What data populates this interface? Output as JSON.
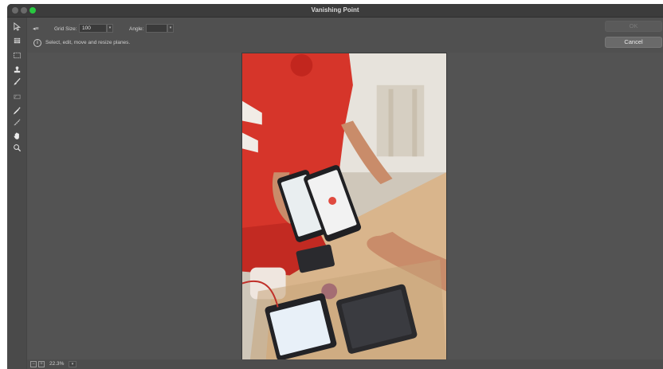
{
  "window": {
    "title": "Vanishing Point"
  },
  "tools": [
    {
      "icon": "edit-plane-icon"
    },
    {
      "icon": "create-plane-icon"
    },
    {
      "icon": "marquee-icon"
    },
    {
      "icon": "stamp-icon"
    },
    {
      "icon": "brush-icon"
    },
    {
      "icon": "transform-icon"
    },
    {
      "icon": "eyedropper-icon"
    },
    {
      "icon": "measure-icon"
    },
    {
      "icon": "hand-icon"
    },
    {
      "icon": "zoom-icon"
    }
  ],
  "options": {
    "back_glyph": "◂≡",
    "grid_size_label": "Grid Size:",
    "grid_size_value": "100",
    "angle_label": "Angle:",
    "angle_value": "",
    "info_text": "Select, edit, move and resize planes."
  },
  "buttons": {
    "ok": "OK",
    "cancel": "Cancel"
  },
  "status": {
    "zoom": "22.3%"
  }
}
